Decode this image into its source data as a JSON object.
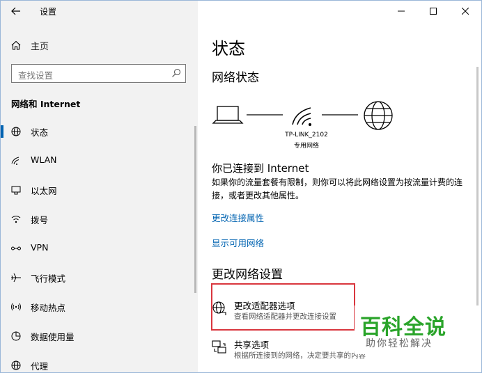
{
  "app": {
    "title": "设置"
  },
  "sidebar": {
    "home_label": "主页",
    "search_placeholder": "查找设置",
    "section_title": "网络和 Internet",
    "items": [
      {
        "label": "状态",
        "icon": "globe-status-icon",
        "active": true
      },
      {
        "label": "WLAN",
        "icon": "wifi-icon"
      },
      {
        "label": "以太网",
        "icon": "ethernet-icon"
      },
      {
        "label": "拨号",
        "icon": "dial-up-icon"
      },
      {
        "label": "VPN",
        "icon": "vpn-icon"
      },
      {
        "label": "飞行模式",
        "icon": "airplane-icon"
      },
      {
        "label": "移动热点",
        "icon": "hotspot-icon"
      },
      {
        "label": "数据使用量",
        "icon": "data-usage-icon"
      },
      {
        "label": "代理",
        "icon": "globe-proxy-icon"
      }
    ]
  },
  "main": {
    "title": "状态",
    "network_status_heading": "网络状态",
    "network": {
      "ssid": "TP-LINK_2102",
      "type": "专用网络"
    },
    "connected_title": "你已连接到 Internet",
    "connected_desc": "如果你的流量套餐有限制，则你可以将此网络设置为按流量计费的连接，或者更改其他属性。",
    "links": {
      "change_properties": "更改连接属性",
      "show_networks": "显示可用网络"
    },
    "change_settings_heading": "更改网络设置",
    "options": [
      {
        "title": "更改适配器选项",
        "subtitle": "查看网络适配器并更改连接设置",
        "icon": "adapter-icon"
      },
      {
        "title": "共享选项",
        "subtitle": "根据所连接到的网络，决定要共享的内容",
        "icon": "sharing-icon"
      }
    ]
  },
  "watermark": {
    "main": "百科全说",
    "sub": "助你轻松解决"
  },
  "colors": {
    "accent": "#0063b1",
    "highlight": "#d9363e",
    "watermark": "#2aa42a",
    "sidebar_bg": "#f2f2f2"
  }
}
